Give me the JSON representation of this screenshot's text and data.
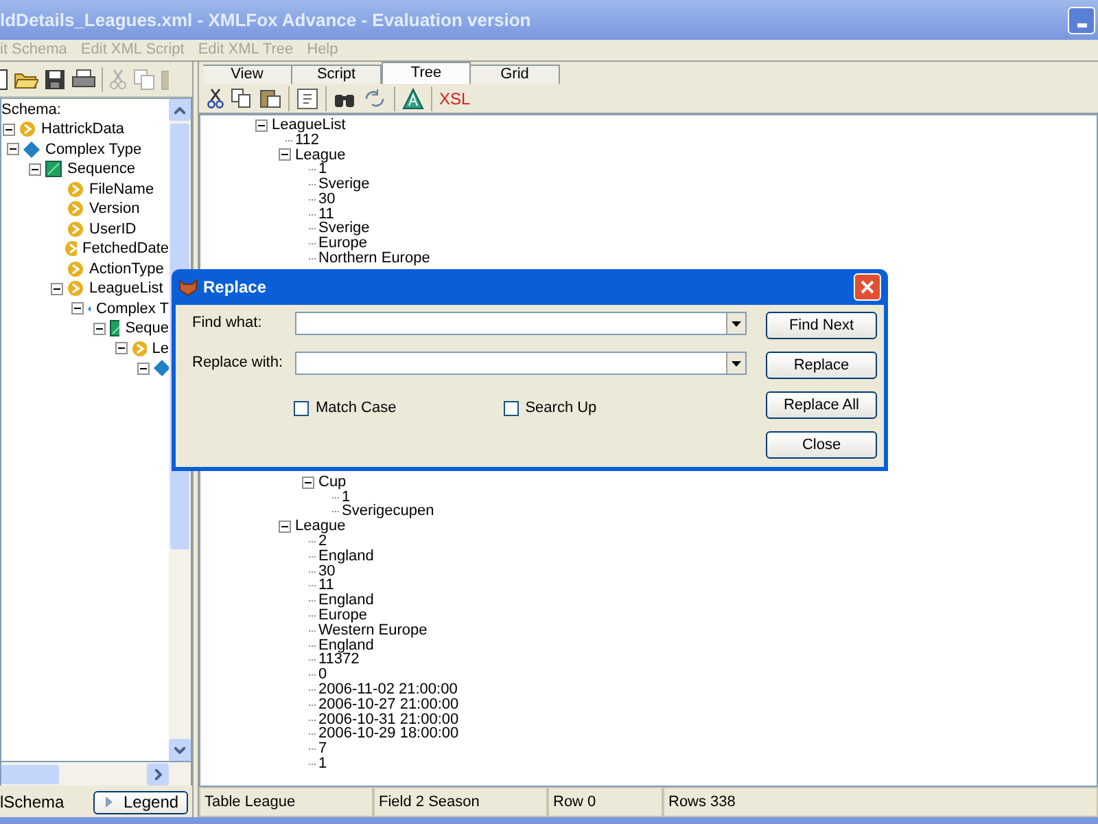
{
  "window": {
    "title": "ldDetails_Leagues.xml - XMLFox Advance - Evaluation version"
  },
  "menu": [
    "it Schema",
    "Edit XML Script",
    "Edit XML Tree",
    "Help"
  ],
  "schema_panel": {
    "label": "Schema:",
    "tree": [
      {
        "label": "HattrickData",
        "kind": "element",
        "expanded": true,
        "children": [
          {
            "label": "Complex Type",
            "kind": "complex",
            "expanded": true,
            "children": [
              {
                "label": "Sequence",
                "kind": "sequence",
                "expanded": true,
                "children": [
                  {
                    "label": "FileName",
                    "kind": "element"
                  },
                  {
                    "label": "Version",
                    "kind": "element"
                  },
                  {
                    "label": "UserID",
                    "kind": "element"
                  },
                  {
                    "label": "FetchedDate",
                    "kind": "element"
                  },
                  {
                    "label": "ActionType",
                    "kind": "element"
                  },
                  {
                    "label": "LeagueList",
                    "kind": "element",
                    "expanded": true,
                    "children": [
                      {
                        "label": "Complex T",
                        "kind": "complex",
                        "expanded": true,
                        "children": [
                          {
                            "label": "Seque",
                            "kind": "sequence",
                            "expanded": true,
                            "children": [
                              {
                                "label": "Le",
                                "kind": "element",
                                "expanded": true,
                                "children": [
                                  {
                                    "kind": "complex",
                                    "expanded": true
                                  }
                                ]
                              }
                            ]
                          }
                        ]
                      }
                    ]
                  }
                ]
              }
            ]
          }
        ]
      }
    ],
    "bottom_tab": "lSchema",
    "legend_button": "Legend"
  },
  "tabs": [
    {
      "label": "View",
      "selected": false
    },
    {
      "label": "Script",
      "selected": false
    },
    {
      "label": "Tree",
      "selected": true
    },
    {
      "label": "Grid",
      "selected": false
    }
  ],
  "toolbar_xsl": "XSL",
  "xml_tree": [
    {
      "label": "LeagueList",
      "expanded": true,
      "children": [
        {
          "label": "112"
        },
        {
          "label": "League",
          "expanded": true,
          "children": [
            {
              "label": "1"
            },
            {
              "label": "Sverige"
            },
            {
              "label": "30"
            },
            {
              "label": "11"
            },
            {
              "label": "Sverige"
            },
            {
              "label": "Europe"
            },
            {
              "label": "Northern Europe"
            },
            {
              "label": "Cup",
              "expanded": true,
              "children": [
                {
                  "label": "1"
                },
                {
                  "label": "Sverigecupen"
                }
              ]
            }
          ]
        },
        {
          "label": "League",
          "expanded": true,
          "children": [
            {
              "label": "2"
            },
            {
              "label": "England"
            },
            {
              "label": "30"
            },
            {
              "label": "11"
            },
            {
              "label": "England"
            },
            {
              "label": "Europe"
            },
            {
              "label": "Western Europe"
            },
            {
              "label": "England"
            },
            {
              "label": "11372"
            },
            {
              "label": "0"
            },
            {
              "label": "2006-11-02 21:00:00"
            },
            {
              "label": "2006-10-27 21:00:00"
            },
            {
              "label": "2006-10-31 21:00:00"
            },
            {
              "label": "2006-10-29 18:00:00"
            },
            {
              "label": "7"
            },
            {
              "label": "1"
            }
          ]
        }
      ]
    }
  ],
  "status_bar": [
    "Table League",
    "Field 2 Season",
    "Row 0",
    "Rows 338"
  ],
  "dialog": {
    "title": "Replace",
    "fields": [
      {
        "label": "Find what:"
      },
      {
        "label": "Replace with:"
      }
    ],
    "checkboxes": [
      {
        "label": "Match Case",
        "checked": false
      },
      {
        "label": "Search Up",
        "checked": false
      }
    ],
    "buttons": [
      "Find Next",
      "Replace",
      "Replace All",
      "Close"
    ]
  }
}
